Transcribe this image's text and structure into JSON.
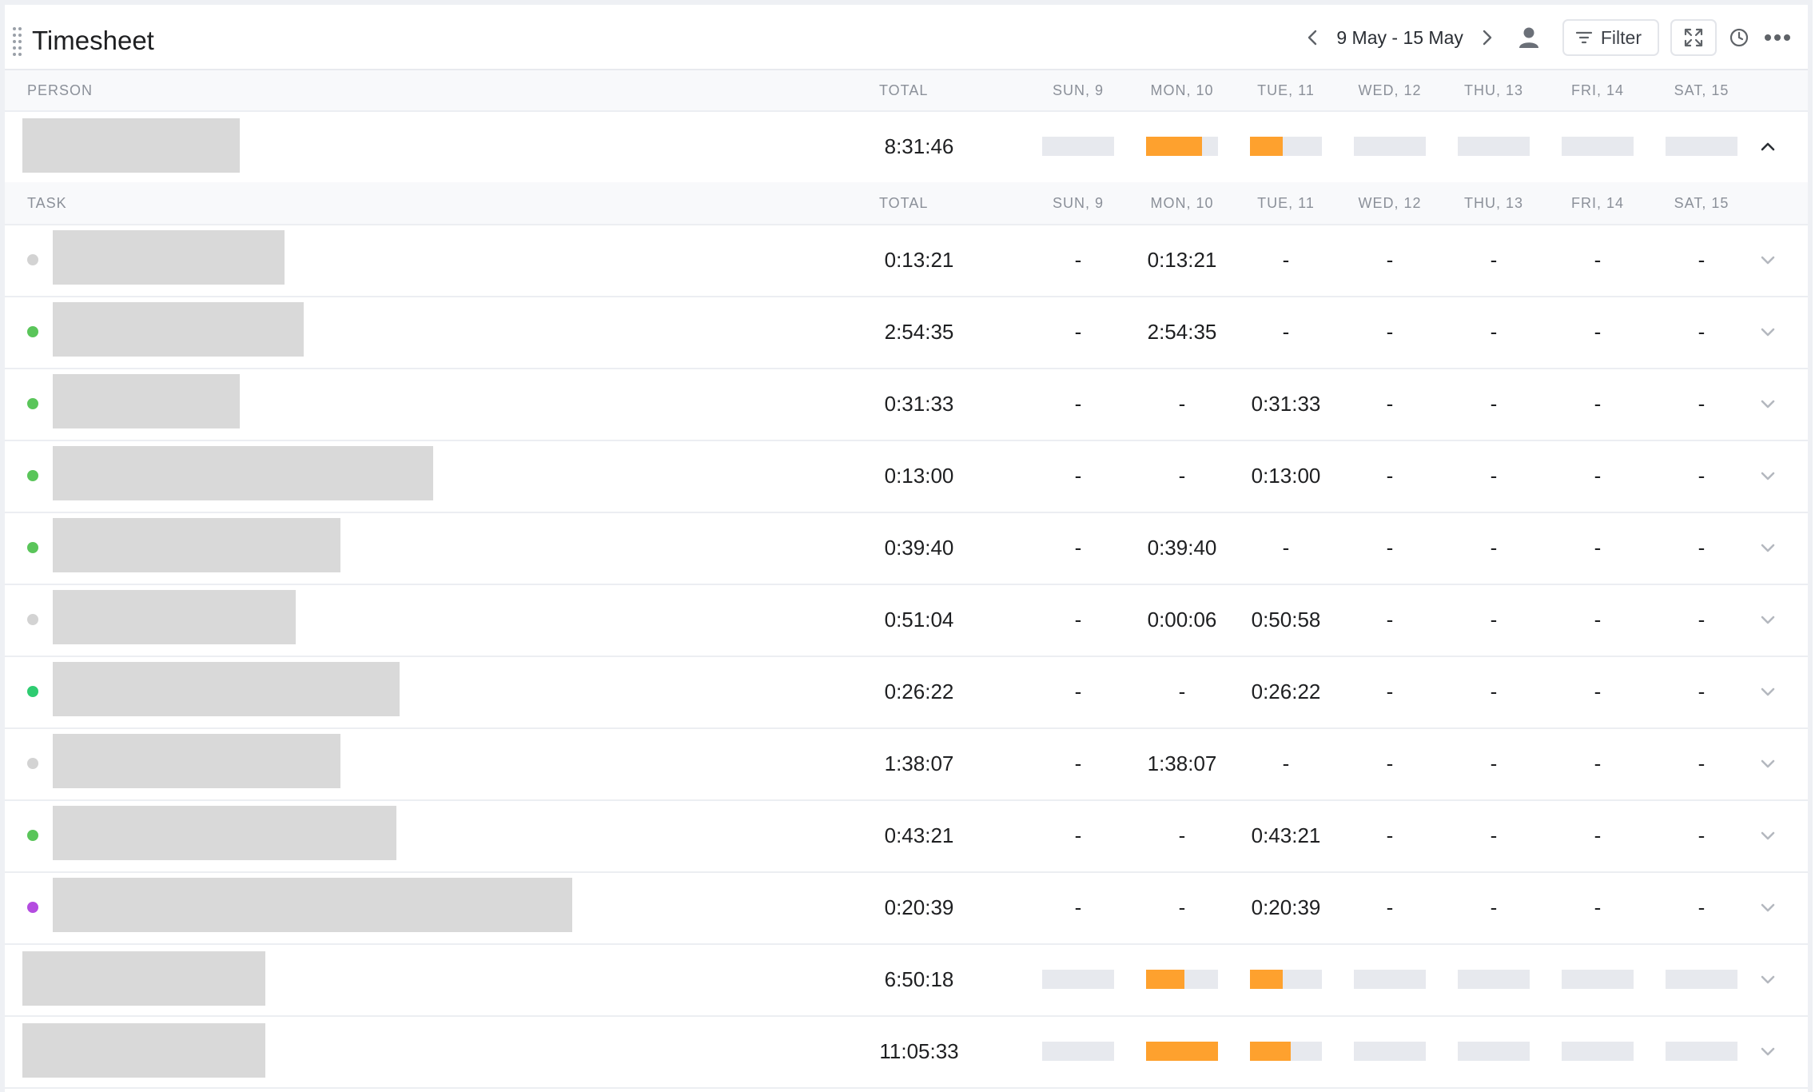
{
  "app": {
    "title": "Timesheet"
  },
  "toolbar": {
    "date_range": "9 May - 15 May",
    "filter_label": "Filter"
  },
  "person_header": {
    "person": "PERSON",
    "total": "TOTAL",
    "days": [
      "SUN, 9",
      "MON, 10",
      "TUE, 11",
      "WED, 12",
      "THU, 13",
      "FRI, 14",
      "SAT, 15"
    ]
  },
  "task_header": {
    "task": "TASK",
    "total": "TOTAL",
    "days": [
      "SUN, 9",
      "MON, 10",
      "TUE, 11",
      "WED, 12",
      "THU, 13",
      "FRI, 14",
      "SAT, 15"
    ]
  },
  "colors": {
    "bar_fill": "#fea12e",
    "bar_empty": "#e7e9ee",
    "status_gray": "#d3d3d3",
    "status_green": "#5ac55a",
    "status_teal": "#2ecc71",
    "status_purple": "#b44ce0"
  },
  "people": [
    {
      "total": "8:31:46",
      "expanded": true,
      "day_fill": [
        0,
        0.78,
        0.45,
        0,
        0,
        0,
        0
      ]
    },
    {
      "total": "6:50:18",
      "expanded": false,
      "day_fill": [
        0,
        0.53,
        0.45,
        0,
        0,
        0,
        0
      ]
    },
    {
      "total": "11:05:33",
      "expanded": false,
      "day_fill": [
        0,
        1.0,
        0.57,
        0,
        0,
        0,
        0
      ]
    }
  ],
  "tasks": [
    {
      "status": "status_gray",
      "total": "0:13:21",
      "days": [
        "-",
        "0:13:21",
        "-",
        "-",
        "-",
        "-",
        "-"
      ]
    },
    {
      "status": "status_green",
      "total": "2:54:35",
      "days": [
        "-",
        "2:54:35",
        "-",
        "-",
        "-",
        "-",
        "-"
      ]
    },
    {
      "status": "status_green",
      "total": "0:31:33",
      "days": [
        "-",
        "-",
        "0:31:33",
        "-",
        "-",
        "-",
        "-"
      ]
    },
    {
      "status": "status_green",
      "total": "0:13:00",
      "days": [
        "-",
        "-",
        "0:13:00",
        "-",
        "-",
        "-",
        "-"
      ]
    },
    {
      "status": "status_green",
      "total": "0:39:40",
      "days": [
        "-",
        "0:39:40",
        "-",
        "-",
        "-",
        "-",
        "-"
      ]
    },
    {
      "status": "status_gray",
      "total": "0:51:04",
      "days": [
        "-",
        "0:00:06",
        "0:50:58",
        "-",
        "-",
        "-",
        "-"
      ]
    },
    {
      "status": "status_teal",
      "total": "0:26:22",
      "days": [
        "-",
        "-",
        "0:26:22",
        "-",
        "-",
        "-",
        "-"
      ]
    },
    {
      "status": "status_gray",
      "total": "1:38:07",
      "days": [
        "-",
        "1:38:07",
        "-",
        "-",
        "-",
        "-",
        "-"
      ]
    },
    {
      "status": "status_green",
      "total": "0:43:21",
      "days": [
        "-",
        "-",
        "0:43:21",
        "-",
        "-",
        "-",
        "-"
      ]
    },
    {
      "status": "status_purple",
      "total": "0:20:39",
      "days": [
        "-",
        "-",
        "0:20:39",
        "-",
        "-",
        "-",
        "-"
      ]
    }
  ]
}
